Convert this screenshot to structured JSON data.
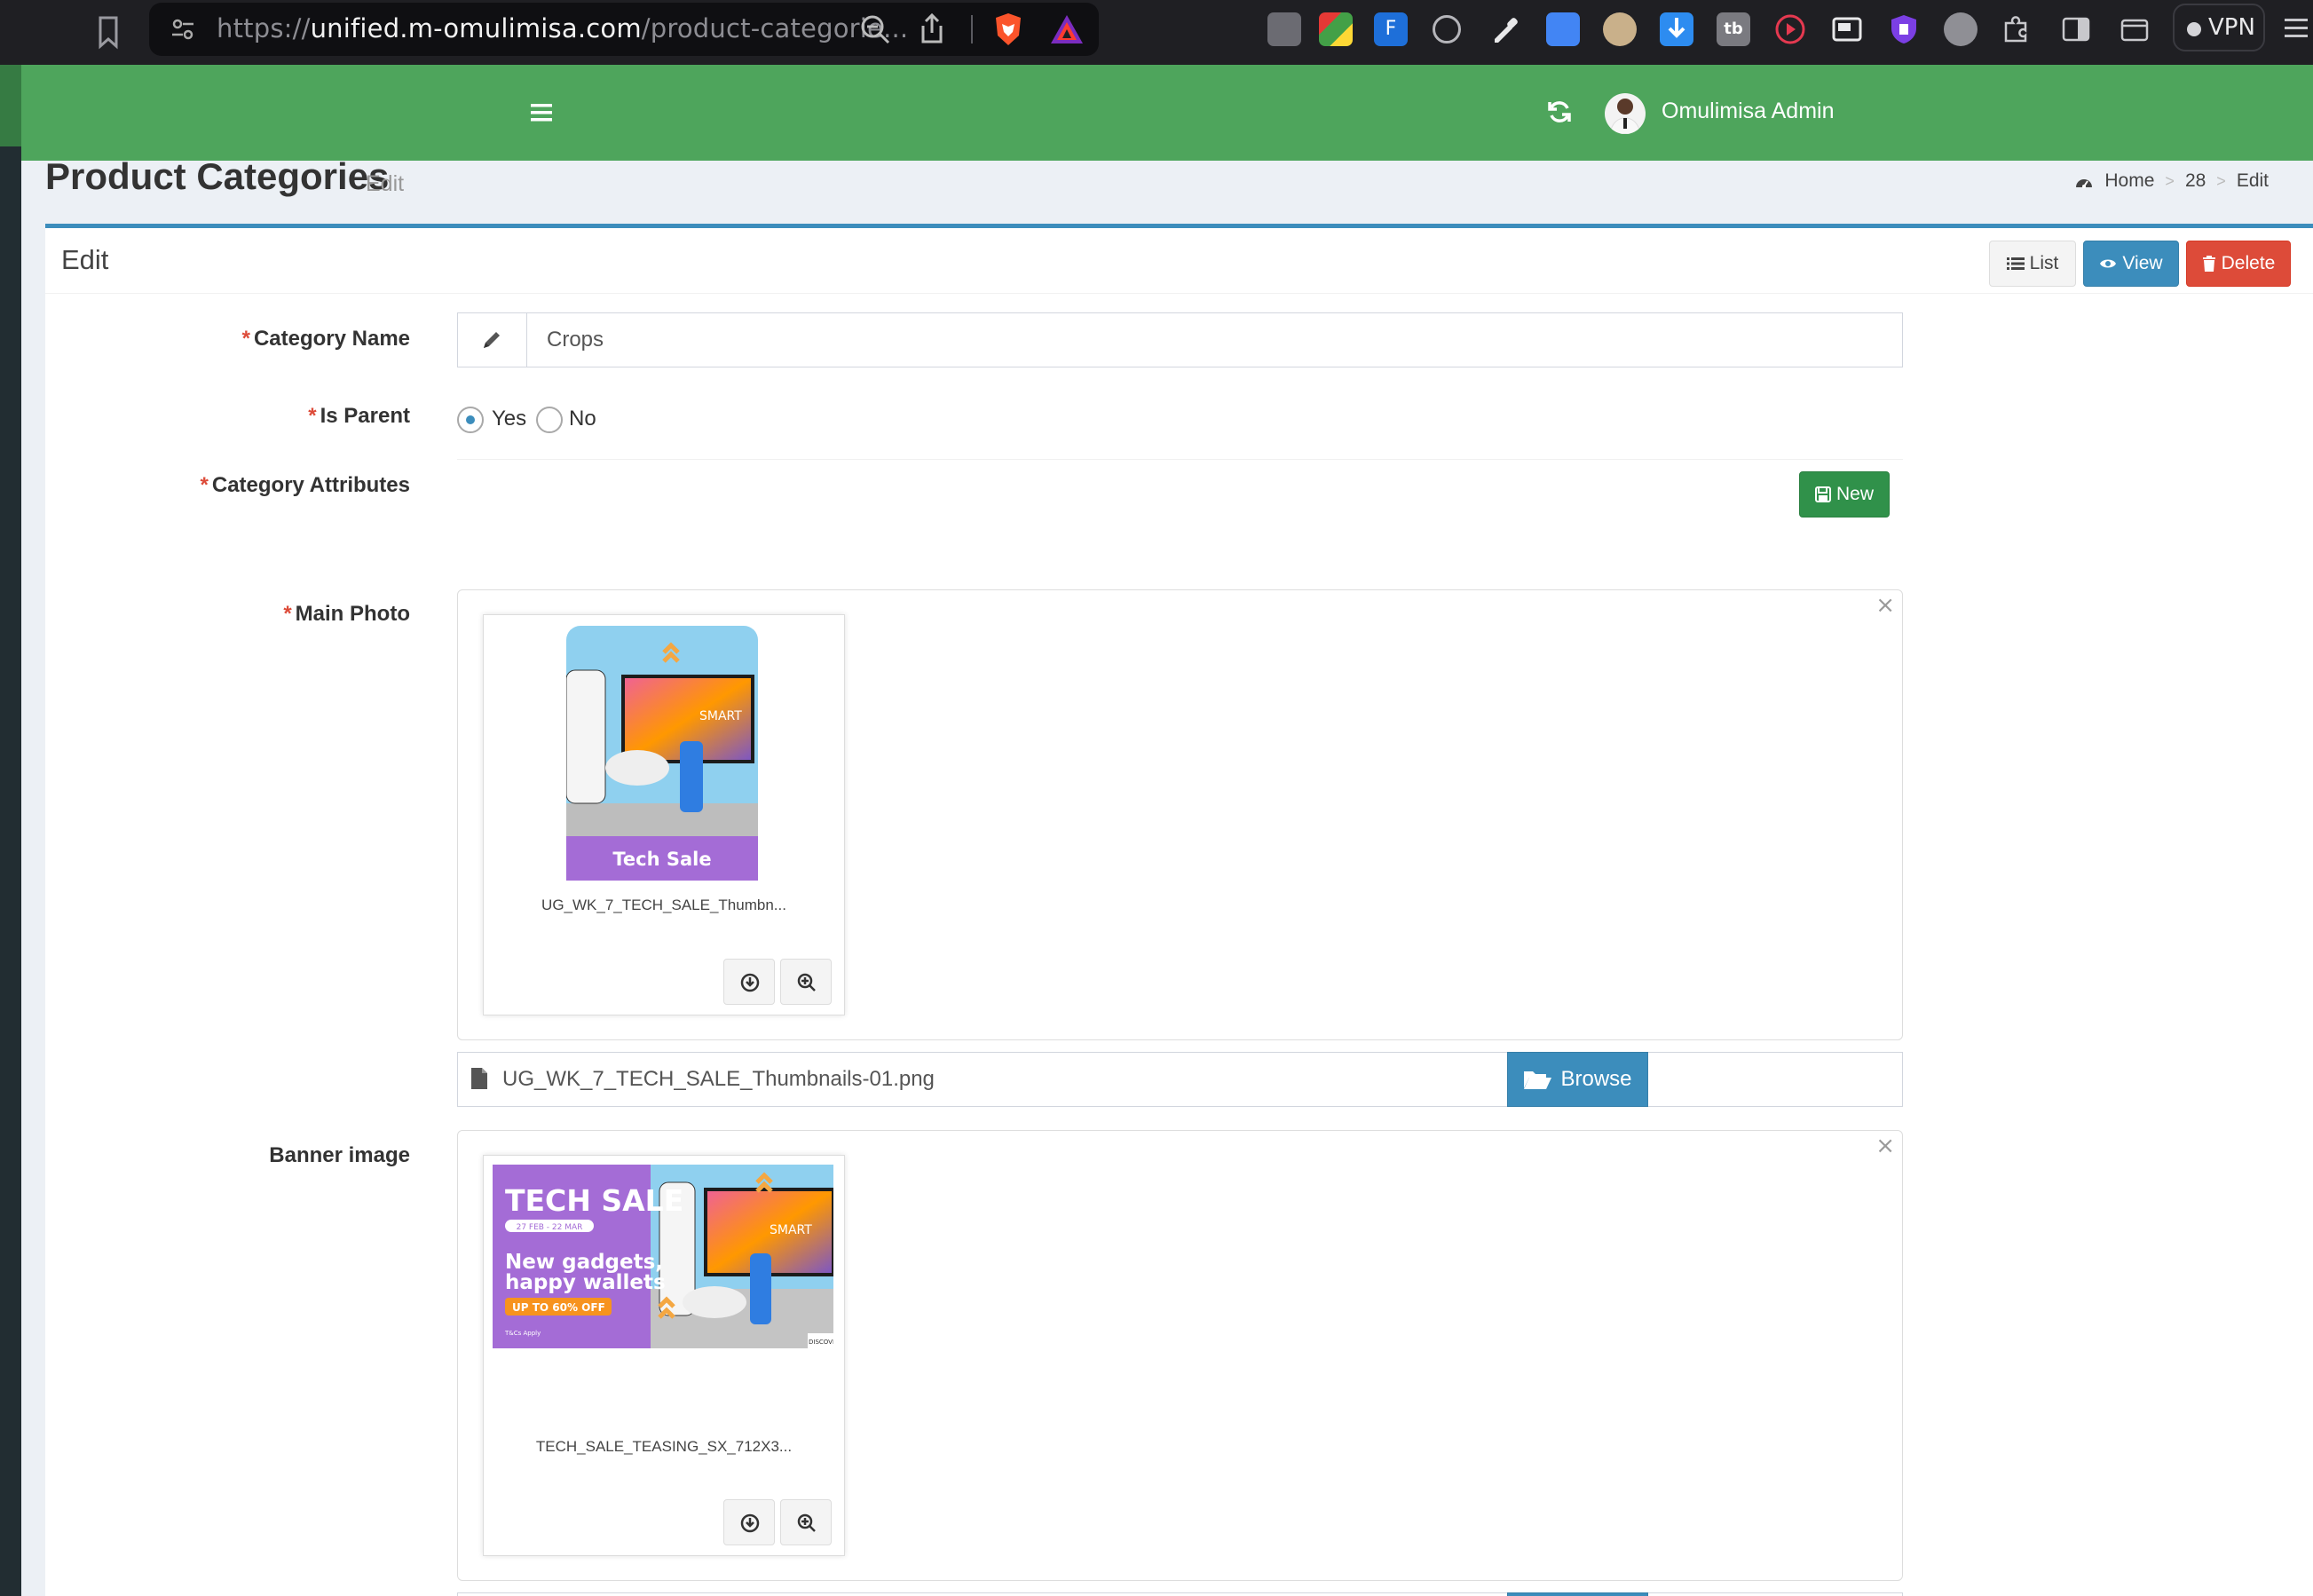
{
  "browser": {
    "url_scheme": "https://",
    "url_host": "unified.m-omulimisa.com",
    "url_path": "/product-categorie...",
    "vpn_label": "VPN"
  },
  "header": {
    "user_name": "Omulimisa Admin"
  },
  "content_header": {
    "title": "Product Categories",
    "subtitle": "Edit",
    "breadcrumb": [
      "Home",
      "28",
      "Edit"
    ]
  },
  "box": {
    "title": "Edit",
    "list_label": "List",
    "view_label": "View",
    "delete_label": "Delete"
  },
  "form": {
    "category_name_label": "Category Name",
    "category_name_value": "Crops",
    "is_parent_label": "Is Parent",
    "is_parent_options": [
      "Yes",
      "No"
    ],
    "is_parent_selected": "Yes",
    "category_attributes_label": "Category Attributes",
    "new_button_label": "New",
    "main_photo_label": "Main Photo",
    "main_photo_caption": "UG_WK_7_TECH_SALE_Thumbn...",
    "main_photo_file": "UG_WK_7_TECH_SALE_Thumbnails-01.png",
    "main_photo_image_text": "Tech Sale",
    "banner_image_label": "Banner image",
    "banner_caption": "TECH_SALE_TEASING_SX_712X3...",
    "banner_text": {
      "headline": "TECH SALE",
      "dates": "27 FEB - 22 MAR",
      "tagline1": "New gadgets,",
      "tagline2": "happy wallets",
      "offer": "UP TO 60% OFF",
      "terms": "T&Cs Apply",
      "cta": "DISCOVER"
    },
    "browse_label": "Browse",
    "required_mark": "*"
  },
  "colors": {
    "header_green": "#4ea55c",
    "primary_blue": "#3c8dbc",
    "danger_red": "#dd4b39",
    "success_green": "#30914a",
    "tech_sale_purple": "#a46cd6"
  }
}
